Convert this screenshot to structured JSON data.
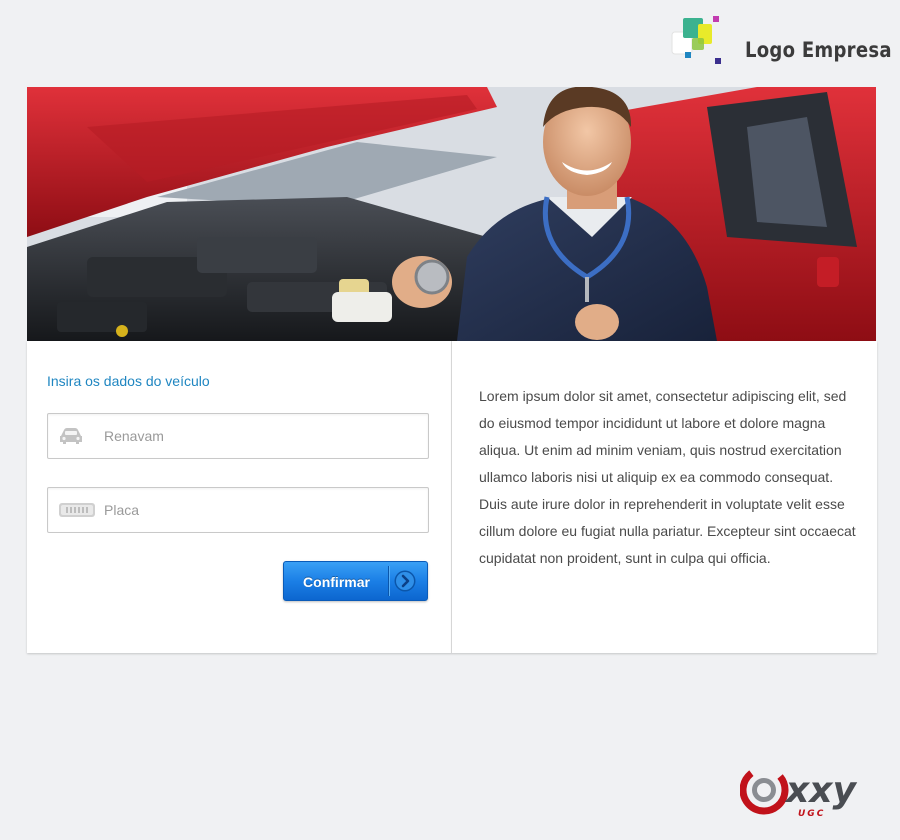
{
  "header": {
    "logo_text": "Logo Empresa",
    "logo_icon": "logo-squares-icon"
  },
  "hero": {
    "image": "mechanic-with-stethoscope-and-car-photo"
  },
  "form": {
    "title": "Insira os dados do veículo",
    "renavam_placeholder": "Renavam",
    "renavam_value": "",
    "renavam_icon": "car-icon",
    "placa_placeholder": "Placa",
    "placa_value": "",
    "placa_icon": "license-plate-icon",
    "submit_label": "Confirmar",
    "submit_icon": "chevron-right-icon"
  },
  "info": {
    "paragraph1": "Lorem ipsum dolor sit amet, consectetur adipiscing elit, sed do eiusmod tempor incididunt ut labore et dolore magna aliqua. Ut enim ad minim veniam, quis nostrud exercitation ullamco laboris nisi ut aliquip ex ea commodo consequat.",
    "paragraph2": "Duis aute irure dolor in reprehenderit in voluptate velit esse cillum dolore eu fugiat nulla pariatur. Excepteur sint occaecat cupidatat non proident, sunt in culpa qui officia."
  },
  "footer": {
    "brand_text": "xxy",
    "brand_subtext": "UGC"
  },
  "colors": {
    "accent": "#1f86c1",
    "button": "#1b7fe6",
    "background": "#f0f1f3"
  }
}
